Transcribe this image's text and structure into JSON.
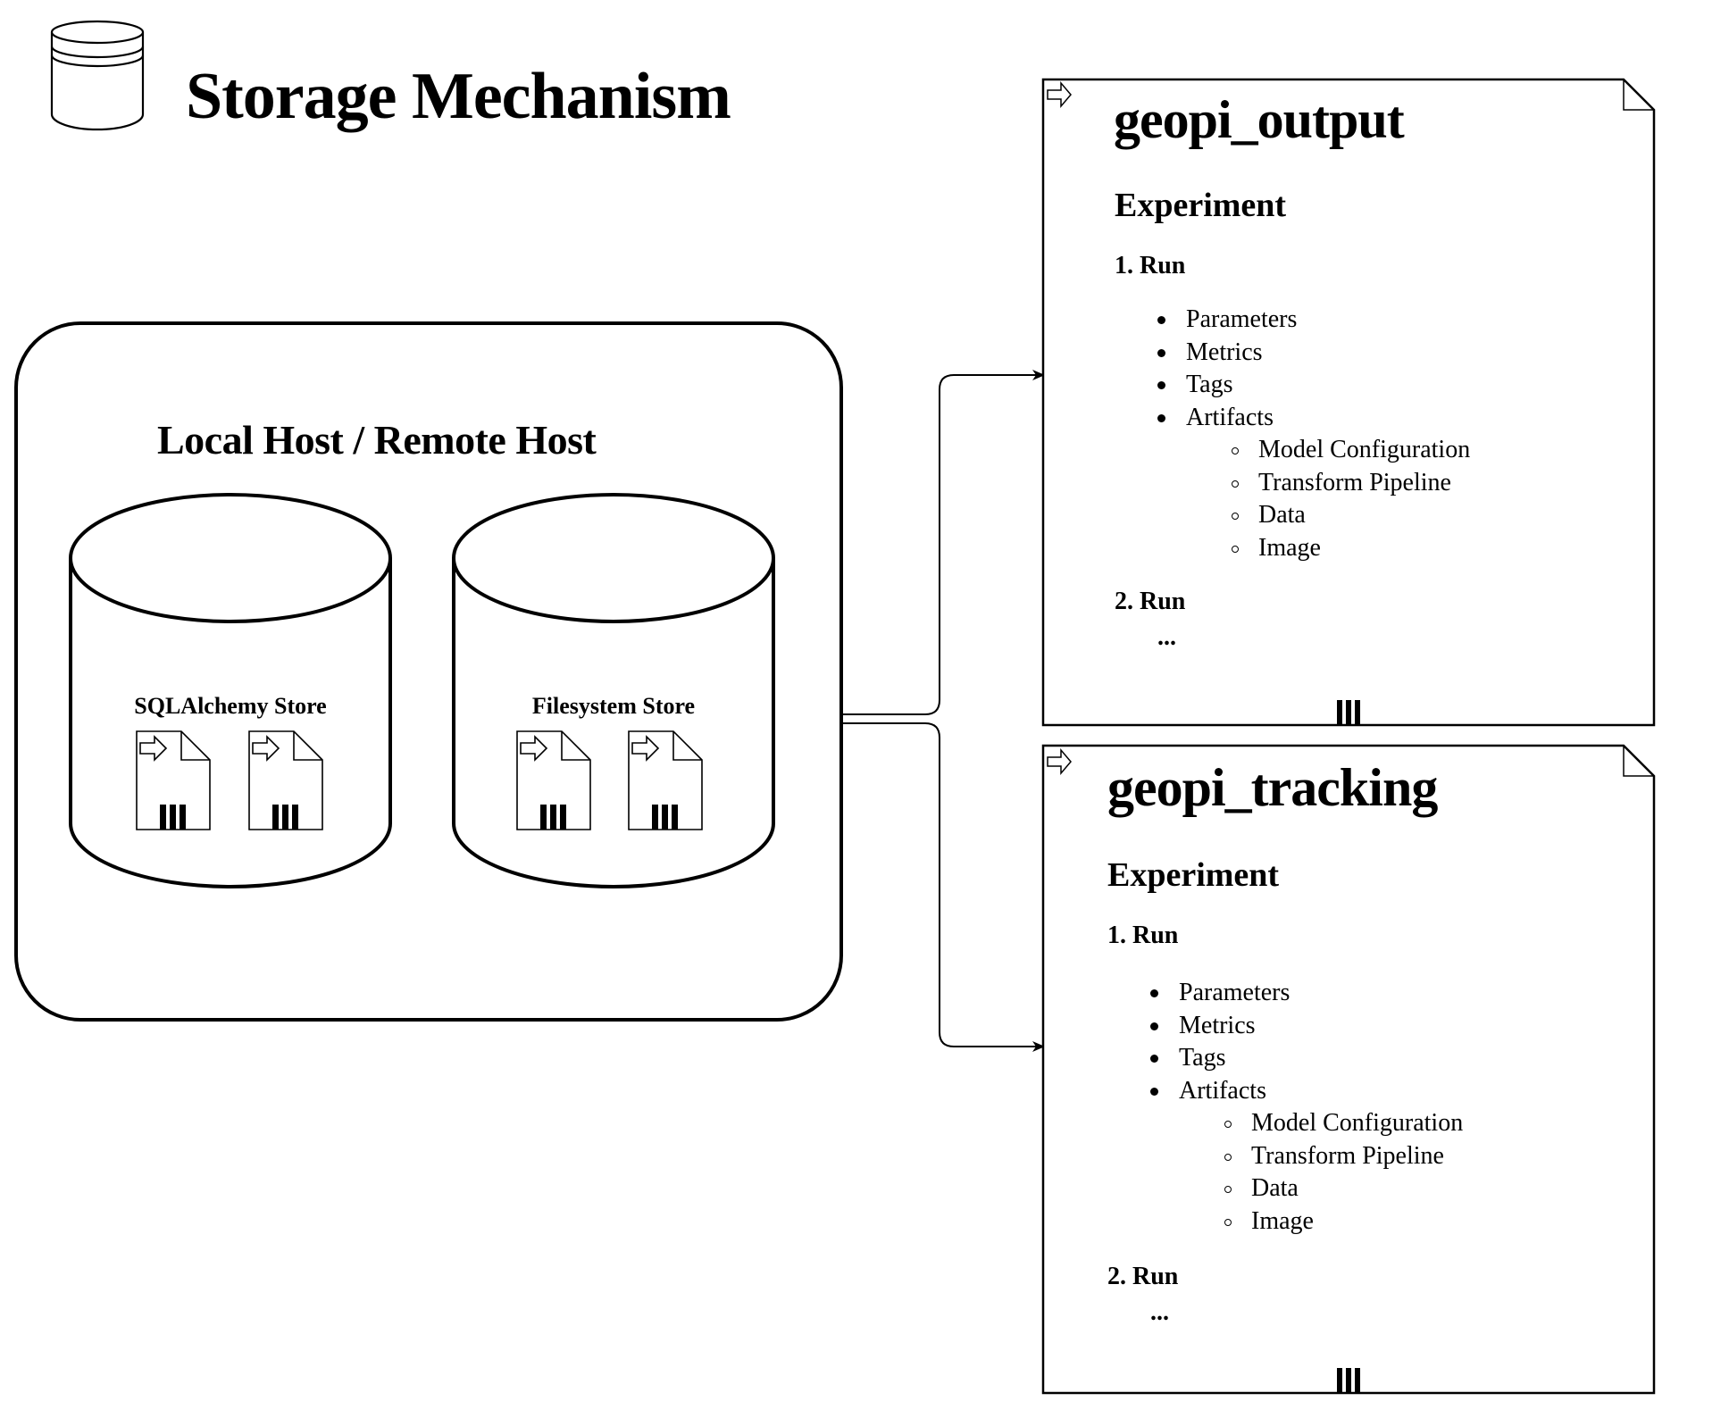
{
  "header": {
    "title": "Storage Mechanism",
    "icon": "database-icon"
  },
  "host": {
    "label": "Local Host / Remote Host",
    "stores": [
      {
        "label": "SQLAlchemy Store",
        "icon": "database-cylinder-icon",
        "files": [
          "file-icon",
          "file-icon"
        ]
      },
      {
        "label": "Filesystem Store",
        "icon": "database-cylinder-icon",
        "files": [
          "file-icon",
          "file-icon"
        ]
      }
    ]
  },
  "documents": [
    {
      "title": "geopi_output",
      "section": "Experiment",
      "run1": "1. Run",
      "items": [
        {
          "label": "Parameters",
          "level": 1
        },
        {
          "label": "Metrics",
          "level": 1
        },
        {
          "label": "Tags",
          "level": 1
        },
        {
          "label": "Artifacts",
          "level": 1
        },
        {
          "label": "Model Configuration",
          "level": 2
        },
        {
          "label": "Transform Pipeline",
          "level": 2
        },
        {
          "label": "Data",
          "level": 2
        },
        {
          "label": "Image",
          "level": 2
        }
      ],
      "run2": "2. Run",
      "ellipsis": "..."
    },
    {
      "title": "geopi_tracking",
      "section": "Experiment",
      "run1": "1. Run",
      "items": [
        {
          "label": "Parameters",
          "level": 1
        },
        {
          "label": "Metrics",
          "level": 1
        },
        {
          "label": "Tags",
          "level": 1
        },
        {
          "label": "Artifacts",
          "level": 1
        },
        {
          "label": "Model Configuration",
          "level": 2
        },
        {
          "label": "Transform Pipeline",
          "level": 2
        },
        {
          "label": "Data",
          "level": 2
        },
        {
          "label": "Image",
          "level": 2
        }
      ],
      "run2": "2. Run",
      "ellipsis": "..."
    }
  ],
  "connectors": [
    {
      "from": "host",
      "to": "geopi_output",
      "type": "arrow"
    },
    {
      "from": "host",
      "to": "geopi_tracking",
      "type": "arrow"
    }
  ]
}
